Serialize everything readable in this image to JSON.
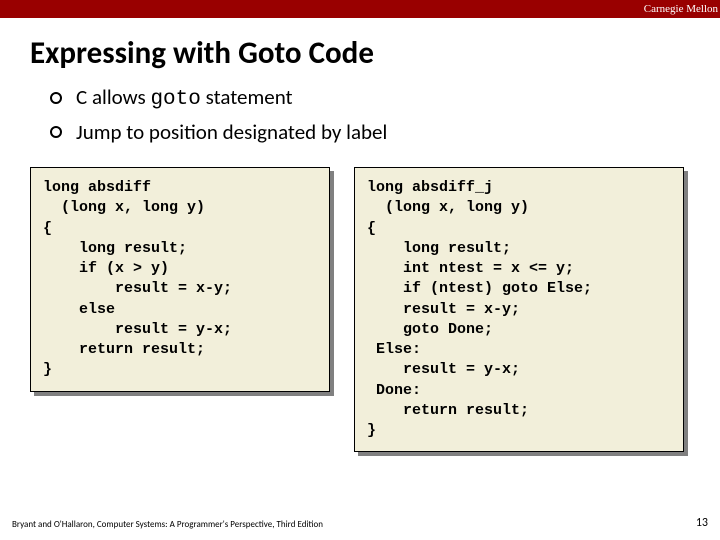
{
  "header": {
    "institution": "Carnegie Mellon"
  },
  "title": "Expressing with Goto Code",
  "bullets": [
    {
      "pre": "C allows ",
      "code": "goto",
      "post": " statement"
    },
    {
      "pre": "Jump to position designated by label",
      "code": "",
      "post": ""
    }
  ],
  "code_left": "long absdiff\n  (long x, long y)\n{\n    long result;\n    if (x > y)\n        result = x-y;\n    else\n        result = y-x;\n    return result;\n}",
  "code_right": "long absdiff_j\n  (long x, long y)\n{\n    long result;\n    int ntest = x <= y;\n    if (ntest) goto Else;\n    result = x-y;\n    goto Done;\n Else:\n    result = y-x;\n Done:\n    return result;\n}",
  "footer": {
    "credit": "Bryant and O'Hallaron, Computer Systems: A Programmer's Perspective, Third Edition",
    "page": "13"
  }
}
